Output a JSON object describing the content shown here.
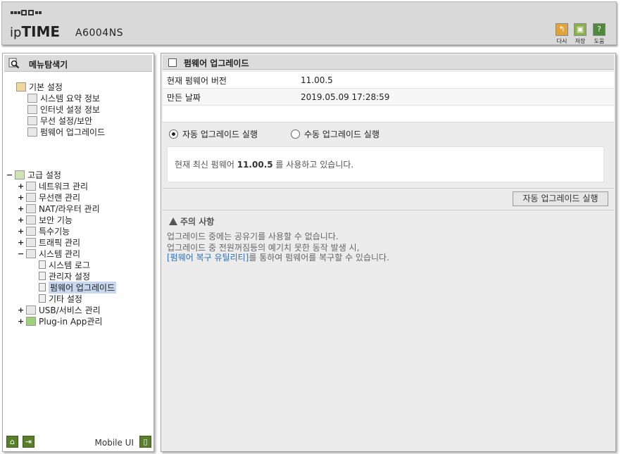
{
  "header": {
    "brand_prefix": "ip",
    "brand_main": "TIME",
    "model": "A6004NS",
    "buttons": [
      {
        "label": "다시",
        "icon": "undo-icon",
        "color": "#e0a43a"
      },
      {
        "label": "저장",
        "icon": "save-icon",
        "color": "#8bb24a"
      },
      {
        "label": "도움",
        "icon": "help-icon",
        "color": "#4e8a3a"
      }
    ]
  },
  "sidebar": {
    "title": "메뉴탐색기",
    "basic": {
      "label": "기본 설정",
      "items": [
        "시스템 요약 정보",
        "인터넷 설정 정보",
        "무선 설정/보안",
        "펌웨어 업그레이드"
      ]
    },
    "advanced": {
      "toggle": "−",
      "label": "고급 설정",
      "items": [
        {
          "toggle": "+",
          "label": "네트워크 관리"
        },
        {
          "toggle": "+",
          "label": "무선랜 관리"
        },
        {
          "toggle": "+",
          "label": "NAT/라우터 관리"
        },
        {
          "toggle": "+",
          "label": "보안 기능"
        },
        {
          "toggle": "+",
          "label": "특수기능"
        },
        {
          "toggle": "+",
          "label": "트래픽 관리"
        },
        {
          "toggle": "−",
          "label": "시스템 관리"
        }
      ],
      "system_children": [
        "시스템 로그",
        "관리자 설정",
        "펌웨어 업그레이드",
        "기타 설정"
      ],
      "tail_items": [
        {
          "toggle": "+",
          "label": "USB/서비스 관리"
        },
        {
          "toggle": "+",
          "label": "Plug-in App관리"
        }
      ]
    },
    "footer": {
      "mobile_label": "Mobile UI"
    }
  },
  "main": {
    "title": "펌웨어 업그레이드",
    "current_version_label": "현재 펌웨어 버전",
    "current_version_value": "11.00.5",
    "build_date_label": "만든 날짜",
    "build_date_value": "2019.05.09 17:28:59",
    "auto_radio": "자동 업그레이드 실행",
    "manual_radio": "수동 업그레이드 실행",
    "status_prefix": "현재 최신 펌웨어 ",
    "status_version": "11.00.5",
    "status_suffix": " 를 사용하고 있습니다.",
    "run_button": "자동 업그레이드 실행",
    "notice_title": "주의 사항",
    "notice_line1": "업그레이드 중에는 공유기를 사용할 수 없습니다.",
    "notice_line2": "업그레이드 중 전원꺼짐등의 예기치 못한 동작 발생 시,",
    "notice_link": "[펌웨어 복구 유틸리티]",
    "notice_line3_suffix": "를 통하여 펌웨어를 복구할 수 있습니다."
  }
}
